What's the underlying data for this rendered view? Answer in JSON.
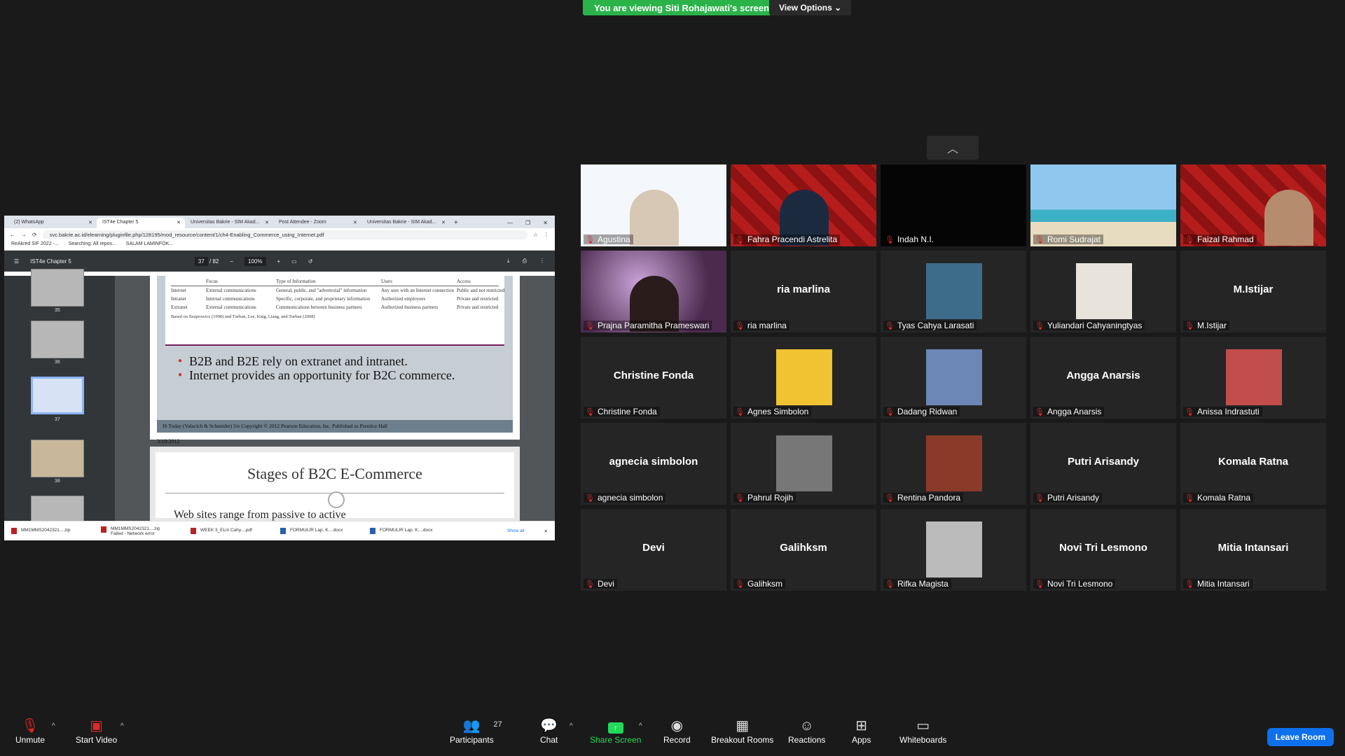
{
  "banner": {
    "text": "You are viewing Siti Rohajawati's screen",
    "view_options": "View Options ⌄"
  },
  "browser": {
    "tabs": [
      "(2) WhatsApp",
      "IST4e Chapter 5",
      "Universitas Bakrie - SIM Akad...",
      "Post Attendee - Zoom",
      "Universitas Bakrie - SIM Akad..."
    ],
    "url": "svc.bakrie.ac.id/elearning/pluginfile.php/128195/mod_resource/content/1/ch4-Enabling_Commerce_using_Internet.pdf",
    "bookmarks": [
      "ReAkred SIF 2022 -...",
      "Searching: All repos...",
      "SALAM LAMINFOK..."
    ]
  },
  "pdf": {
    "title": "IST4e Chapter 5",
    "page_current": "37",
    "page_total": "/ 82",
    "zoom": "100%",
    "thumb_numbers": [
      "35",
      "36",
      "37",
      "38"
    ],
    "table_headers": [
      "",
      "Focus",
      "Type of Information",
      "Users",
      "Access"
    ],
    "table_rows": [
      [
        "Internet",
        "External communications",
        "General, public, and \"advertorial\" information",
        "Any user with an Internet connection",
        "Public and not restricted"
      ],
      [
        "Intranet",
        "Internal communications",
        "Specific, corporate, and proprietary information",
        "Authorized employees",
        "Private and restricted"
      ],
      [
        "Extranet",
        "External communications",
        "Communications between business partners",
        "Authorized business partners",
        "Private and restricted"
      ]
    ],
    "table_note": "Based on Szuprowicz (1998) and Turban, Lee, King, Liang, and Turban (2008)",
    "bullets": [
      "B2B  and B2E rely on extranet and intranet.",
      "Internet provides an opportunity for B2C commerce."
    ],
    "footer": "IS Today (Valacich & Schneider) 5/e     Copyright © 2012 Pearson Education, Inc. Published as Prentice Hall",
    "date": "3/18/2012",
    "next_title": "Stages of B2C E-Commerce",
    "next_bullet": "Web sites range from passive to active"
  },
  "downloads": {
    "items": [
      {
        "name": "MM1MMS2042321....zip",
        "sub": ""
      },
      {
        "name": "MM1MMS2042321....zip",
        "sub": "Failed - Network error"
      },
      {
        "name": "WEEK 3_ELin Cahy....pdf",
        "sub": ""
      },
      {
        "name": "FORMULIR Lap. K....docx",
        "sub": ""
      },
      {
        "name": "FORMULIR Lap. K....docx",
        "sub": ""
      }
    ],
    "show_all": "Show all"
  },
  "participants_tiles": [
    "Agustina",
    "Fahra Pracendi Astrelita",
    "Indah N.I.",
    "Romi Sudrajat",
    "Faizal Rahmad",
    "Prajna Paramitha Prameswari",
    "ria marlina",
    "Tyas Cahya Larasati",
    "Yuliandari Cahyaningtyas",
    "M.Istijar",
    "Christine Fonda",
    "Agnes Simbolon",
    "Dadang Ridwan",
    "Angga Anarsis",
    "Anissa Indrastuti",
    "agnecia simbolon",
    "Pahrul Rojih",
    "Rentina Pandora",
    "Putri Arisandy",
    "Komala Ratna",
    "Devi",
    "Galihksm",
    "Rifka Magista",
    "Novi Tri Lesmono",
    "Mitia Intansari"
  ],
  "toolbar": {
    "unmute": "Unmute",
    "start_video": "Start Video",
    "participants": "Participants",
    "participants_count": "27",
    "chat": "Chat",
    "share_screen": "Share Screen",
    "record": "Record",
    "breakout": "Breakout Rooms",
    "reactions": "Reactions",
    "apps": "Apps",
    "whiteboards": "Whiteboards",
    "leave": "Leave Room"
  }
}
